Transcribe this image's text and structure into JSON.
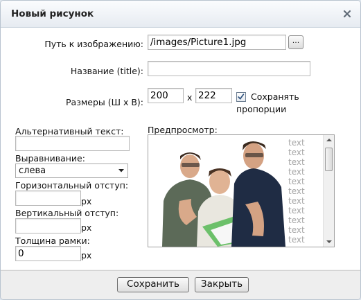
{
  "dialog": {
    "title": "Новый рисунок"
  },
  "form": {
    "path": {
      "label": "Путь к изображению:",
      "value": "/images/Picture1.jpg",
      "browse_label": "..."
    },
    "name": {
      "label": "Название (title):",
      "value": ""
    },
    "size": {
      "label": "Размеры (Ш х В):",
      "width": "200",
      "separator": "x",
      "height": "222",
      "keep_ratio_label_1": "Сохранять",
      "keep_ratio_label_2": "пропорции",
      "keep_ratio_checked": true
    },
    "alt": {
      "label": "Альтернативный текст:",
      "value": ""
    },
    "align": {
      "label": "Выравнивание:",
      "value": "слева"
    },
    "hspace": {
      "label": "Горизонтальный отступ:",
      "value": "",
      "unit": "px"
    },
    "vspace": {
      "label": "Вертикальный отступ:",
      "value": "",
      "unit": "px"
    },
    "border": {
      "label": "Толщина рамки:",
      "value": "0",
      "unit": "px"
    }
  },
  "preview": {
    "label": "Предпросмотр:",
    "filler_text": [
      "text",
      "text",
      "text",
      "text",
      "text",
      "text",
      "text",
      "text",
      "text",
      "text",
      "text"
    ]
  },
  "buttons": {
    "save": "Сохранить",
    "close": "Закрыть"
  },
  "icons": {
    "close": "close-icon",
    "dropdown": "chevron-down-icon",
    "check": "checkmark-icon"
  },
  "colors": {
    "header_gradient_top": "#fbfcfe",
    "header_gradient_bottom": "#e6ebf1",
    "footer": "#eeeeee",
    "checkmark": "#2b4f7c",
    "preview_text": "#a7a7a7"
  }
}
